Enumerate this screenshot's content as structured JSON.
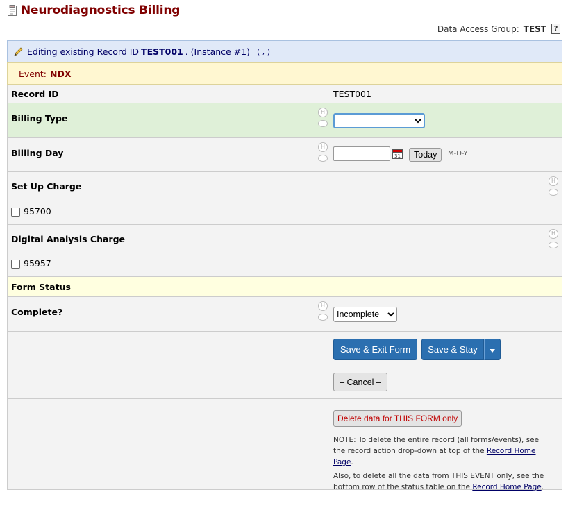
{
  "page": {
    "title": "Neurodiagnostics Billing"
  },
  "dag": {
    "label": "Data Access Group:",
    "value": "TEST",
    "help": "?"
  },
  "editing": {
    "prefix": "Editing existing Record ID",
    "record_id": "TEST001",
    "instance": ". (Instance #1)",
    "context": "( , )"
  },
  "event": {
    "label": "Event:",
    "value": "NDX"
  },
  "fields": {
    "record_id": {
      "label": "Record ID",
      "value": "TEST001"
    },
    "billing_type": {
      "label": "Billing Type",
      "value": ""
    },
    "billing_day": {
      "label": "Billing Day",
      "value": "",
      "today": "Today",
      "format": "M-D-Y"
    },
    "setup_charge": {
      "label": "Set Up Charge",
      "option": "95700",
      "checked": false
    },
    "digital_charge": {
      "label": "Digital Analysis Charge",
      "option": "95957",
      "checked": false
    }
  },
  "status": {
    "section_label": "Form Status",
    "complete_label": "Complete?",
    "value": "Incomplete"
  },
  "actions": {
    "save_exit": "Save & Exit Form",
    "save_stay": "Save & Stay",
    "cancel": "– Cancel –",
    "delete": "Delete data for THIS FORM only",
    "note1_text": "NOTE: To delete the entire record (all forms/events), see the record action drop-down at top of the",
    "note1_link": "Record Home Page",
    "note2_text": "Also, to delete all the data from THIS EVENT only, see the bottom row of the status table on the",
    "note2_link": "Record Home Page"
  },
  "icons": {
    "history": "H",
    "comment": "comment-bubble-icon"
  },
  "colors": {
    "title": "#800000",
    "button": "#2b6fb0",
    "highlight": "#dff0d8",
    "section": "#ffffe0",
    "delete_text": "#c00000"
  }
}
